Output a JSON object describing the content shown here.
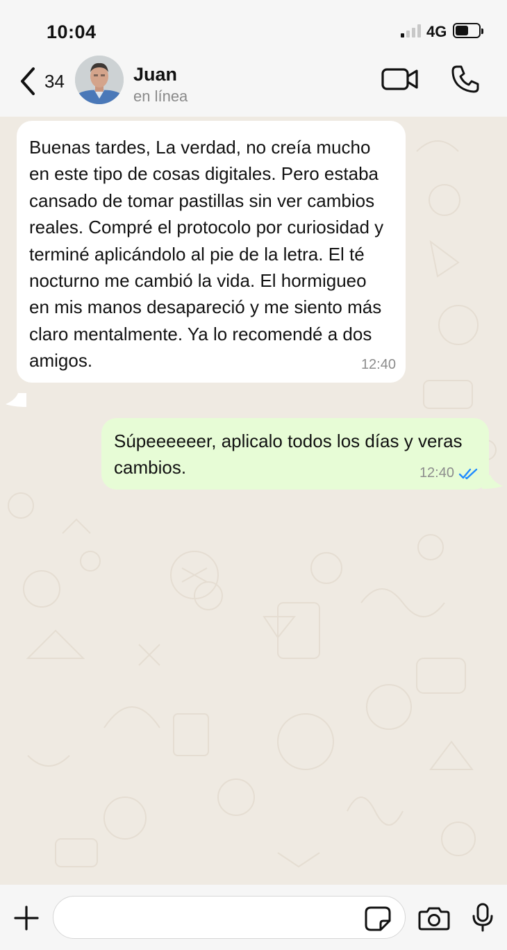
{
  "status_bar": {
    "time": "10:04",
    "network": "4G",
    "signal_bars_on": 1,
    "battery_level": 0.45
  },
  "header": {
    "back_count": "34",
    "contact_name": "Juan",
    "contact_status": "en línea"
  },
  "messages": [
    {
      "direction": "incoming",
      "text": "Buenas tardes, La verdad, no creía mucho en este tipo de cosas digitales. Pero estaba cansado de tomar pastillas sin ver cambios reales. Compré el protocolo por curiosidad y terminé aplicándolo al pie de la letra. El té nocturno me cambió la vida. El hormigueo en mis manos desapareció y me siento más claro mentalmente. Ya lo recomendé a dos amigos.",
      "time": "12:40"
    },
    {
      "direction": "outgoing",
      "text": "Súpeeeeeer, aplicalo todos los días y veras cambios.",
      "time": "12:40",
      "status": "read"
    }
  ],
  "input": {
    "placeholder": "",
    "value": ""
  },
  "colors": {
    "chat_background": "#efeae2",
    "incoming_bubble": "#ffffff",
    "outgoing_bubble": "#e7fcd6",
    "read_ticks": "#1f8bff",
    "bar_background": "#f6f6f6"
  },
  "icons": {
    "back": "chevron-left-icon",
    "video": "video-camera-icon",
    "call": "phone-icon",
    "attach": "plus-icon",
    "sticker": "sticker-icon",
    "camera": "camera-icon",
    "mic": "microphone-icon",
    "read": "double-check-icon"
  }
}
